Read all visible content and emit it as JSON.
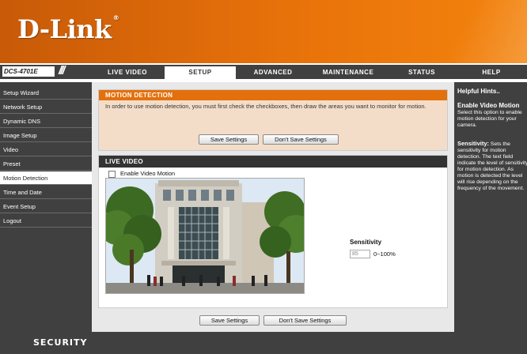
{
  "brand": {
    "logo": "D-Link",
    "model": "DCS-4701E"
  },
  "nav": {
    "tabs": [
      {
        "label": "LIVE VIDEO",
        "active": false
      },
      {
        "label": "SETUP",
        "active": true
      },
      {
        "label": "ADVANCED",
        "active": false
      },
      {
        "label": "MAINTENANCE",
        "active": false
      },
      {
        "label": "STATUS",
        "active": false
      },
      {
        "label": "HELP",
        "active": false
      }
    ]
  },
  "sidebar": {
    "items": [
      {
        "label": "Setup Wizard"
      },
      {
        "label": "Network Setup"
      },
      {
        "label": "Dynamic DNS"
      },
      {
        "label": "Image Setup"
      },
      {
        "label": "Video"
      },
      {
        "label": "Preset"
      },
      {
        "label": "Motion Detection",
        "active": true
      },
      {
        "label": "Time and Date"
      },
      {
        "label": "Event Setup"
      },
      {
        "label": "Logout"
      }
    ]
  },
  "motion": {
    "title": "MOTION DETECTION",
    "description": "In order to use motion detection, you must first check the checkboxes, then draw the areas you want to monitor for motion.",
    "save_label": "Save Settings",
    "dont_save_label": "Don't Save Settings"
  },
  "live": {
    "title": "LIVE VIDEO",
    "enable_label": "Enable Video Motion",
    "enable_checked": false,
    "sensitivity_label": "Sensitivity",
    "sensitivity_value": "85",
    "sensitivity_range": "0~100%"
  },
  "bottom": {
    "save_label": "Save Settings",
    "dont_save_label": "Don't Save Settings"
  },
  "hints": {
    "title": "Helpful Hints..",
    "enable_title": "Enable Video Motion",
    "enable_text": "Select this option to enable motion detection for your camera.",
    "sensitivity_title": "Sensitivity:",
    "sensitivity_text": "Sets the sensitivity for motion detection. The text field indicate the level of sensitivity for motion detection. As motion is detected the level will rise depending on the frequency of the movement."
  },
  "footer": {
    "label": "SECURITY"
  },
  "colors": {
    "accent": "#e3700c",
    "dark": "#404040",
    "panel": "#e8e8e8"
  }
}
